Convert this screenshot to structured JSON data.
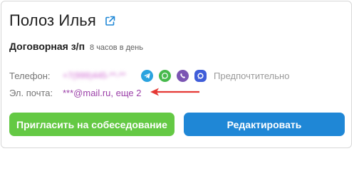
{
  "candidate": {
    "name": "Полоз Илья",
    "open_link_icon": "external-link-icon"
  },
  "job": {
    "title": "Договорная з/п",
    "hours": "8 часов в день"
  },
  "contacts": {
    "phone_label": "Телефон:",
    "phone_value": "+7(999)445-**-**",
    "messengers": [
      "telegram-icon",
      "whatsapp-icon",
      "viber-icon",
      "max-messenger-icon"
    ],
    "preferred_label": "Предпочтительно",
    "email_label": "Эл. почта:",
    "email_value": "***@mail.ru, еще 2"
  },
  "actions": {
    "invite_label": "Пригласить на собеседование",
    "edit_label": "Редактировать"
  },
  "colors": {
    "invite_button": "#64c944",
    "edit_button": "#1f87d6",
    "link": "#9b3fa8",
    "annotation_arrow": "#e53935"
  }
}
